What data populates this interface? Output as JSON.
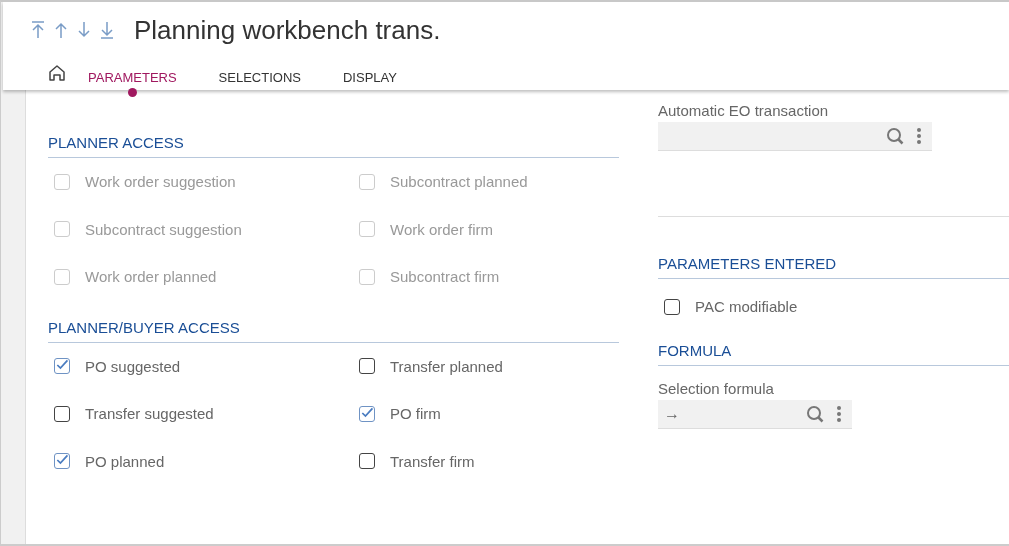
{
  "header": {
    "title": "Planning workbench trans.",
    "tabs": [
      {
        "label": "PARAMETERS",
        "selected": true
      },
      {
        "label": "SELECTIONS",
        "selected": false
      },
      {
        "label": "DISPLAY",
        "selected": false
      }
    ]
  },
  "left_sections": [
    {
      "title": "PLANNER ACCESS",
      "items": [
        {
          "label": "Work order suggestion",
          "checked": false,
          "disabled": true
        },
        {
          "label": "Subcontract planned",
          "checked": false,
          "disabled": true
        },
        {
          "label": "Subcontract suggestion",
          "checked": false,
          "disabled": true
        },
        {
          "label": "Work order firm",
          "checked": false,
          "disabled": true
        },
        {
          "label": "Work order planned",
          "checked": false,
          "disabled": true
        },
        {
          "label": "Subcontract firm",
          "checked": false,
          "disabled": true
        }
      ]
    },
    {
      "title": "PLANNER/BUYER ACCESS",
      "items": [
        {
          "label": "PO suggested",
          "checked": true,
          "disabled": false
        },
        {
          "label": "Transfer planned",
          "checked": false,
          "disabled": false
        },
        {
          "label": "Transfer suggested",
          "checked": false,
          "disabled": false
        },
        {
          "label": "PO firm",
          "checked": true,
          "disabled": false
        },
        {
          "label": "PO planned",
          "checked": true,
          "disabled": false
        },
        {
          "label": "Transfer firm",
          "checked": false,
          "disabled": false
        }
      ]
    }
  ],
  "automatic_eo": {
    "label": "Automatic EO transaction"
  },
  "parameters_entered": {
    "title": "PARAMETERS ENTERED",
    "items": [
      {
        "label": "PAC modifiable",
        "checked": false,
        "disabled": false
      }
    ]
  },
  "formula": {
    "title": "FORMULA",
    "field": {
      "label": "Selection formula",
      "arrow": "→"
    }
  }
}
